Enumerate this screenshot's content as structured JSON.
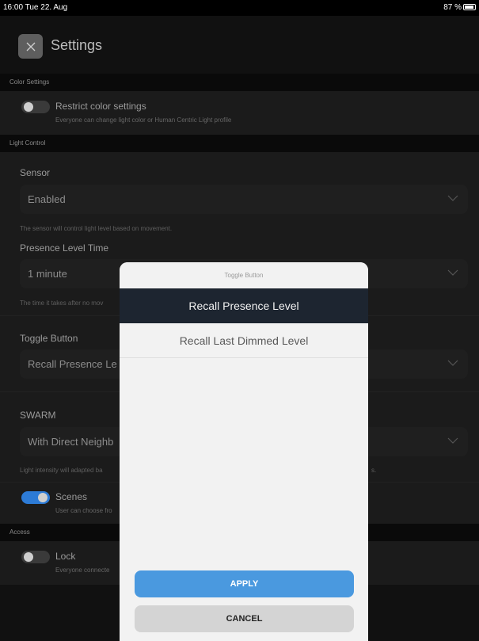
{
  "statusbar": {
    "time": "16:00  Tue 22. Aug",
    "battery": "87 %"
  },
  "header": {
    "title": "Settings",
    "close_icon": "close-icon"
  },
  "sections": {
    "color_settings": "Color Settings",
    "light_control": "Light Control",
    "access": "Access"
  },
  "restrict_color": {
    "title": "Restrict color settings",
    "subtitle": "Everyone can change light color or Human Centric Light profile",
    "enabled": false
  },
  "sensor": {
    "label": "Sensor",
    "value": "Enabled",
    "hint": "The sensor will control light level based on movement."
  },
  "presence_level_time": {
    "label": "Presence Level Time",
    "value": "1 minute",
    "hint": "The time it takes after no mov"
  },
  "toggle_button": {
    "label": "Toggle Button",
    "value": "Recall Presence Le"
  },
  "swarm": {
    "label": "SWARM",
    "value": "With Direct Neighb",
    "hint": "Light intensity will adapted ba",
    "hint_tail": "s."
  },
  "scenes": {
    "title": "Scenes",
    "subtitle": "User can choose fro",
    "enabled": true
  },
  "lock": {
    "title": "Lock",
    "subtitle": "Everyone connecte",
    "enabled": false
  },
  "modal": {
    "title": "Toggle Button",
    "options": [
      "Recall Presence Level",
      "Recall Last Dimmed Level"
    ],
    "selected_index": 0,
    "apply_label": "APPLY",
    "cancel_label": "CANCEL"
  },
  "colors": {
    "accent": "#4a99df",
    "toggle_on": "#2d7bd6",
    "background": "#111111"
  }
}
